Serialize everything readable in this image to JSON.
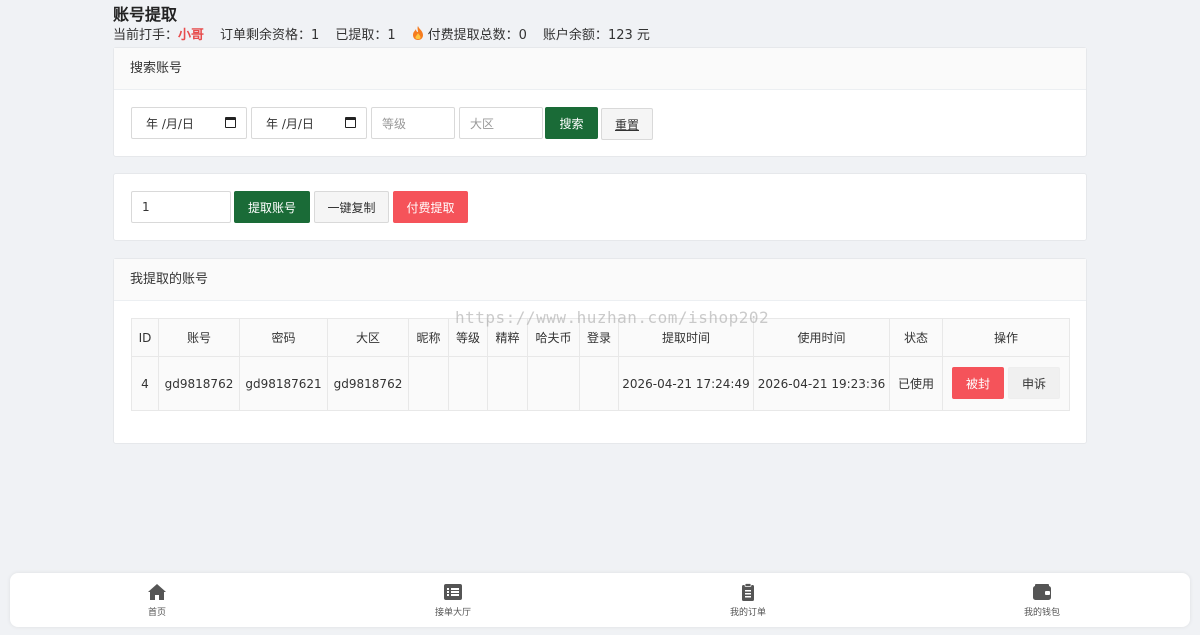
{
  "page": {
    "title": "账号提取"
  },
  "info": {
    "player_label": "当前打手：",
    "player_name": "小哥",
    "order_left_label": "订单剩余资格：",
    "order_left_value": "1",
    "extracted_label": "已提取：",
    "extracted_value": "1",
    "paid_total_label": "付费提取总数：",
    "paid_total_value": "0",
    "balance_label": "账户余额：",
    "balance_value": "123 元"
  },
  "search": {
    "header": "搜索账号",
    "date_start": "年 /月/日",
    "date_end": "年 /月/日",
    "level_placeholder": "等级",
    "region_placeholder": "大区",
    "search_button": "搜索",
    "reset_button": "重置"
  },
  "extract": {
    "quantity": "1",
    "extract_button": "提取账号",
    "copy_button": "一键复制",
    "paid_button": "付费提取"
  },
  "accounts": {
    "header": "我提取的账号",
    "columns": [
      "ID",
      "账号",
      "密码",
      "大区",
      "昵称",
      "等级",
      "精粹",
      "哈夫币",
      "登录",
      "提取时间",
      "使用时间",
      "状态",
      "操作"
    ],
    "rows": [
      {
        "id": "4",
        "account": "gd9818762",
        "password": "gd98187621",
        "region": "gd9818762",
        "nickname": "",
        "level": "",
        "essence": "",
        "coins": "",
        "login": "",
        "extract_time": "2026-04-21 17:24:49",
        "use_time": "2026-04-21 19:23:36",
        "status": "已使用",
        "ban_button": "被封",
        "appeal_button": "申诉"
      }
    ]
  },
  "watermark": "https://www.huzhan.com/ishop202",
  "tabbar": {
    "items": [
      {
        "label": "首页",
        "icon": "home-icon"
      },
      {
        "label": "接单大厅",
        "icon": "list-icon"
      },
      {
        "label": "我的订单",
        "icon": "clipboard-icon"
      },
      {
        "label": "我的钱包",
        "icon": "wallet-icon"
      }
    ]
  },
  "colors": {
    "accent_green": "#1a6b37",
    "danger_red": "#f5535a",
    "highlight_red": "#e74c4c"
  }
}
